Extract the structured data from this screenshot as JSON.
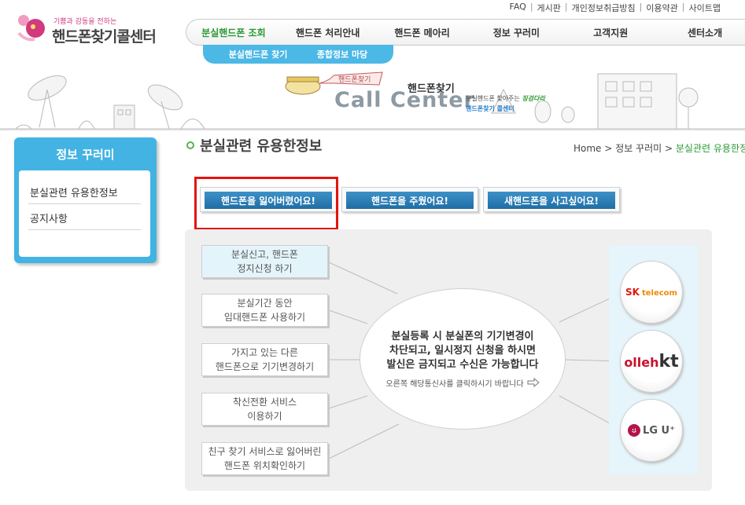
{
  "util_links": [
    "FAQ",
    "게시판",
    "개인정보취급방침",
    "이용약관",
    "사이트맵"
  ],
  "logo": {
    "tagline": "기쁨과 감동을 전하는",
    "name": "핸드폰찾기콜센터"
  },
  "nav": {
    "items": [
      "분실핸드폰 조회",
      "핸드폰 처리안내",
      "핸드폰 메아리",
      "정보 꾸러미",
      "고객지원",
      "센터소개"
    ],
    "sub": [
      "분실핸드폰 찾기",
      "종합정보 마당"
    ]
  },
  "banner": {
    "sign": "핸드폰찾기",
    "title_small": "핸드폰찾기",
    "title_big": "Call Center",
    "desc_prefix": "분실핸드폰 찾아주는",
    "desc_highlight": "징검다리",
    "desc_line2": "핸드폰찾기 콜센터"
  },
  "sidebar": {
    "title": "정보 꾸러미",
    "items": [
      "분실관련 유용한정보",
      "공지사항"
    ]
  },
  "content": {
    "title": "분실관련 유용한정보",
    "breadcrumb": {
      "home": "Home",
      "section": "정보 꾸러미",
      "current": "분실관련 유용한정보"
    }
  },
  "tabs": [
    "핸드폰을 잃어버렸어요!",
    "핸드폰을 주웠어요!",
    "새핸드폰을 사고싶어요!"
  ],
  "options": [
    "분실신고, 핸드폰\n정지신청 하기",
    "분실기간 동안\n임대핸드폰 사용하기",
    "가지고 있는 다른\n핸드폰으로 기기변경하기",
    "착신전환 서비스\n이용하기",
    "친구 찾기 서비스로 잃어버린\n핸드폰 위치확인하기"
  ],
  "center": {
    "message": "분실등록 시 분실폰의 기기변경이\n차단되고, 일시정지 신청을 하시면\n발신은 금지되고 수신은 가능합니다",
    "hint": "오른쪽 해당통신사를 클릭하시기 바랍니다"
  },
  "carriers": {
    "sk": {
      "main": "SK",
      "sub": "telecom"
    },
    "kt": {
      "main": "olleh",
      "sub": "kt"
    },
    "lg": {
      "main": "LG U⁺"
    }
  },
  "colors": {
    "accent_green": "#2b9a35",
    "accent_blue": "#42b3e3",
    "highlight_red": "#e3150e"
  }
}
